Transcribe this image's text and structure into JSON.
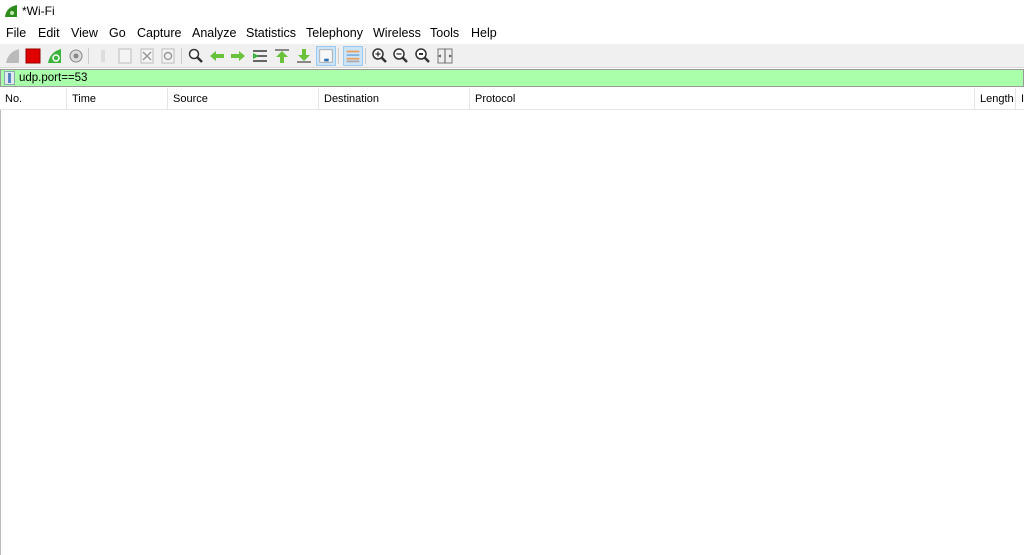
{
  "window": {
    "title": "*Wi-Fi"
  },
  "menu": [
    "File",
    "Edit",
    "View",
    "Go",
    "Capture",
    "Analyze",
    "Statistics",
    "Telephony",
    "Wireless",
    "Tools",
    "Help"
  ],
  "toolbar": [
    {
      "icon": "shark-fin-start-icon",
      "enabled": false
    },
    {
      "icon": "stop-capture-icon",
      "color": "#e00000"
    },
    {
      "icon": "restart-capture-icon"
    },
    {
      "icon": "capture-options-icon"
    },
    {
      "icon": "open-file-icon",
      "enabled": false
    },
    {
      "icon": "save-file-icon",
      "enabled": false
    },
    {
      "icon": "close-file-icon",
      "enabled": false
    },
    {
      "icon": "reload-file-icon",
      "enabled": false
    },
    {
      "icon": "find-packet-icon"
    },
    {
      "icon": "go-back-icon"
    },
    {
      "icon": "go-forward-icon"
    },
    {
      "icon": "go-to-packet-icon"
    },
    {
      "icon": "first-packet-icon"
    },
    {
      "icon": "last-packet-icon"
    },
    {
      "icon": "auto-scroll-icon",
      "selected": true
    },
    {
      "icon": "colorize-icon",
      "selected": true
    },
    {
      "icon": "zoom-in-icon"
    },
    {
      "icon": "zoom-out-icon"
    },
    {
      "icon": "normal-size-icon"
    },
    {
      "icon": "resize-columns-icon"
    }
  ],
  "filter": {
    "value": "udp.port==53",
    "bg": "#aaffaa"
  },
  "columns": [
    "No.",
    "Time",
    "Source",
    "Destination",
    "Protocol",
    "Length",
    "I"
  ]
}
